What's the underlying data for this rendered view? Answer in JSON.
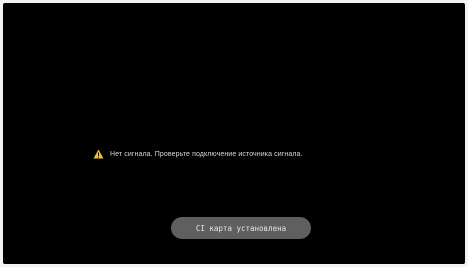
{
  "screen": {
    "warning": {
      "icon": "warning-icon",
      "icon_color": "#f2c12e",
      "text": "Нет сигнала. Проверьте подключение источника сигнала."
    },
    "toast": {
      "text": "CI карта установлена"
    }
  }
}
